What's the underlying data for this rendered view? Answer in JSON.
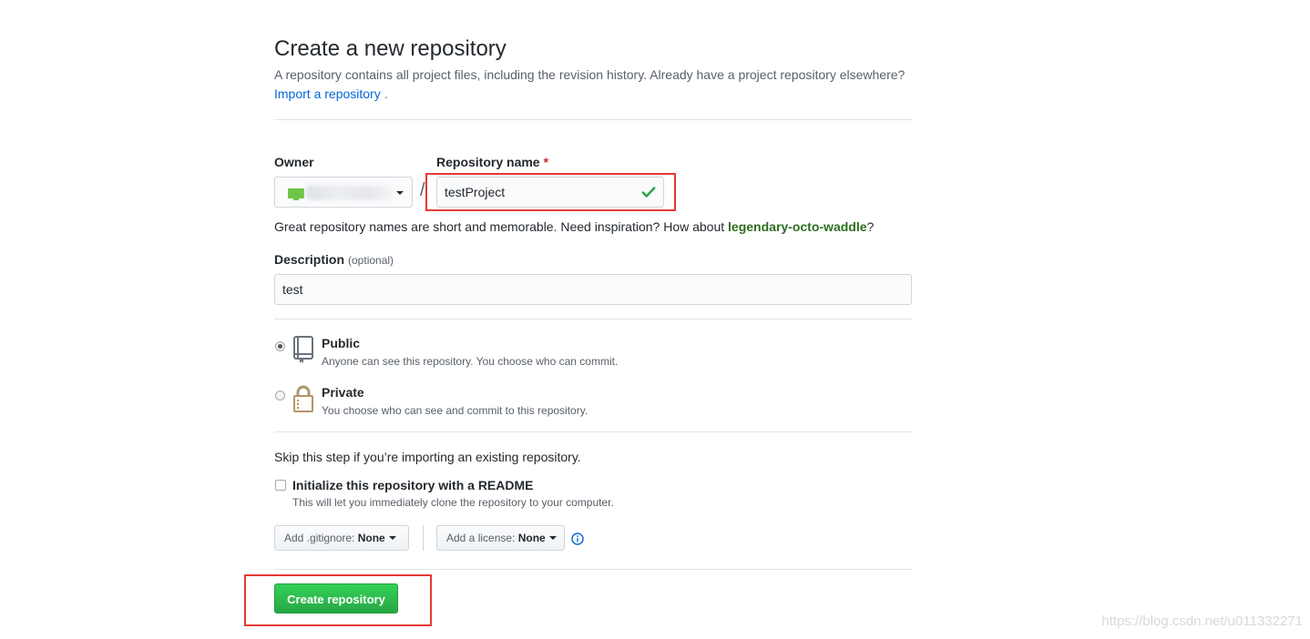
{
  "header": {
    "title": "Create a new repository",
    "subtitle": "A repository contains all project files, including the revision history. Already have a project repository elsewhere?",
    "import_link": "Import a repository",
    "import_period": "."
  },
  "owner": {
    "label": "Owner"
  },
  "repo_name": {
    "label": "Repository name",
    "required_mark": "*",
    "value": "testProject",
    "hint_prefix": "Great repository names are short and memorable. Need inspiration? How about ",
    "suggestion": "legendary-octo-waddle",
    "hint_suffix": "?"
  },
  "separator": "/",
  "description": {
    "label": "Description",
    "optional": "(optional)",
    "value": "test"
  },
  "visibility": {
    "public": {
      "title": "Public",
      "desc": "Anyone can see this repository. You choose who can commit."
    },
    "private": {
      "title": "Private",
      "desc": "You choose who can see and commit to this repository."
    },
    "selected": "Public"
  },
  "init": {
    "skip_text": "Skip this step if you’re importing an existing repository.",
    "readme_label": "Initialize this repository with a README",
    "readme_desc": "This will let you immediately clone the repository to your computer.",
    "gitignore_prefix": "Add .gitignore:",
    "gitignore_value": "None",
    "license_prefix": "Add a license:",
    "license_value": "None"
  },
  "actions": {
    "create_label": "Create repository"
  },
  "watermark": "https://blog.csdn.net/u011332271",
  "colors": {
    "highlight_box": "#e53935",
    "create_button": "#2cbe4e",
    "link": "#0366d6",
    "check": "#28a745"
  }
}
